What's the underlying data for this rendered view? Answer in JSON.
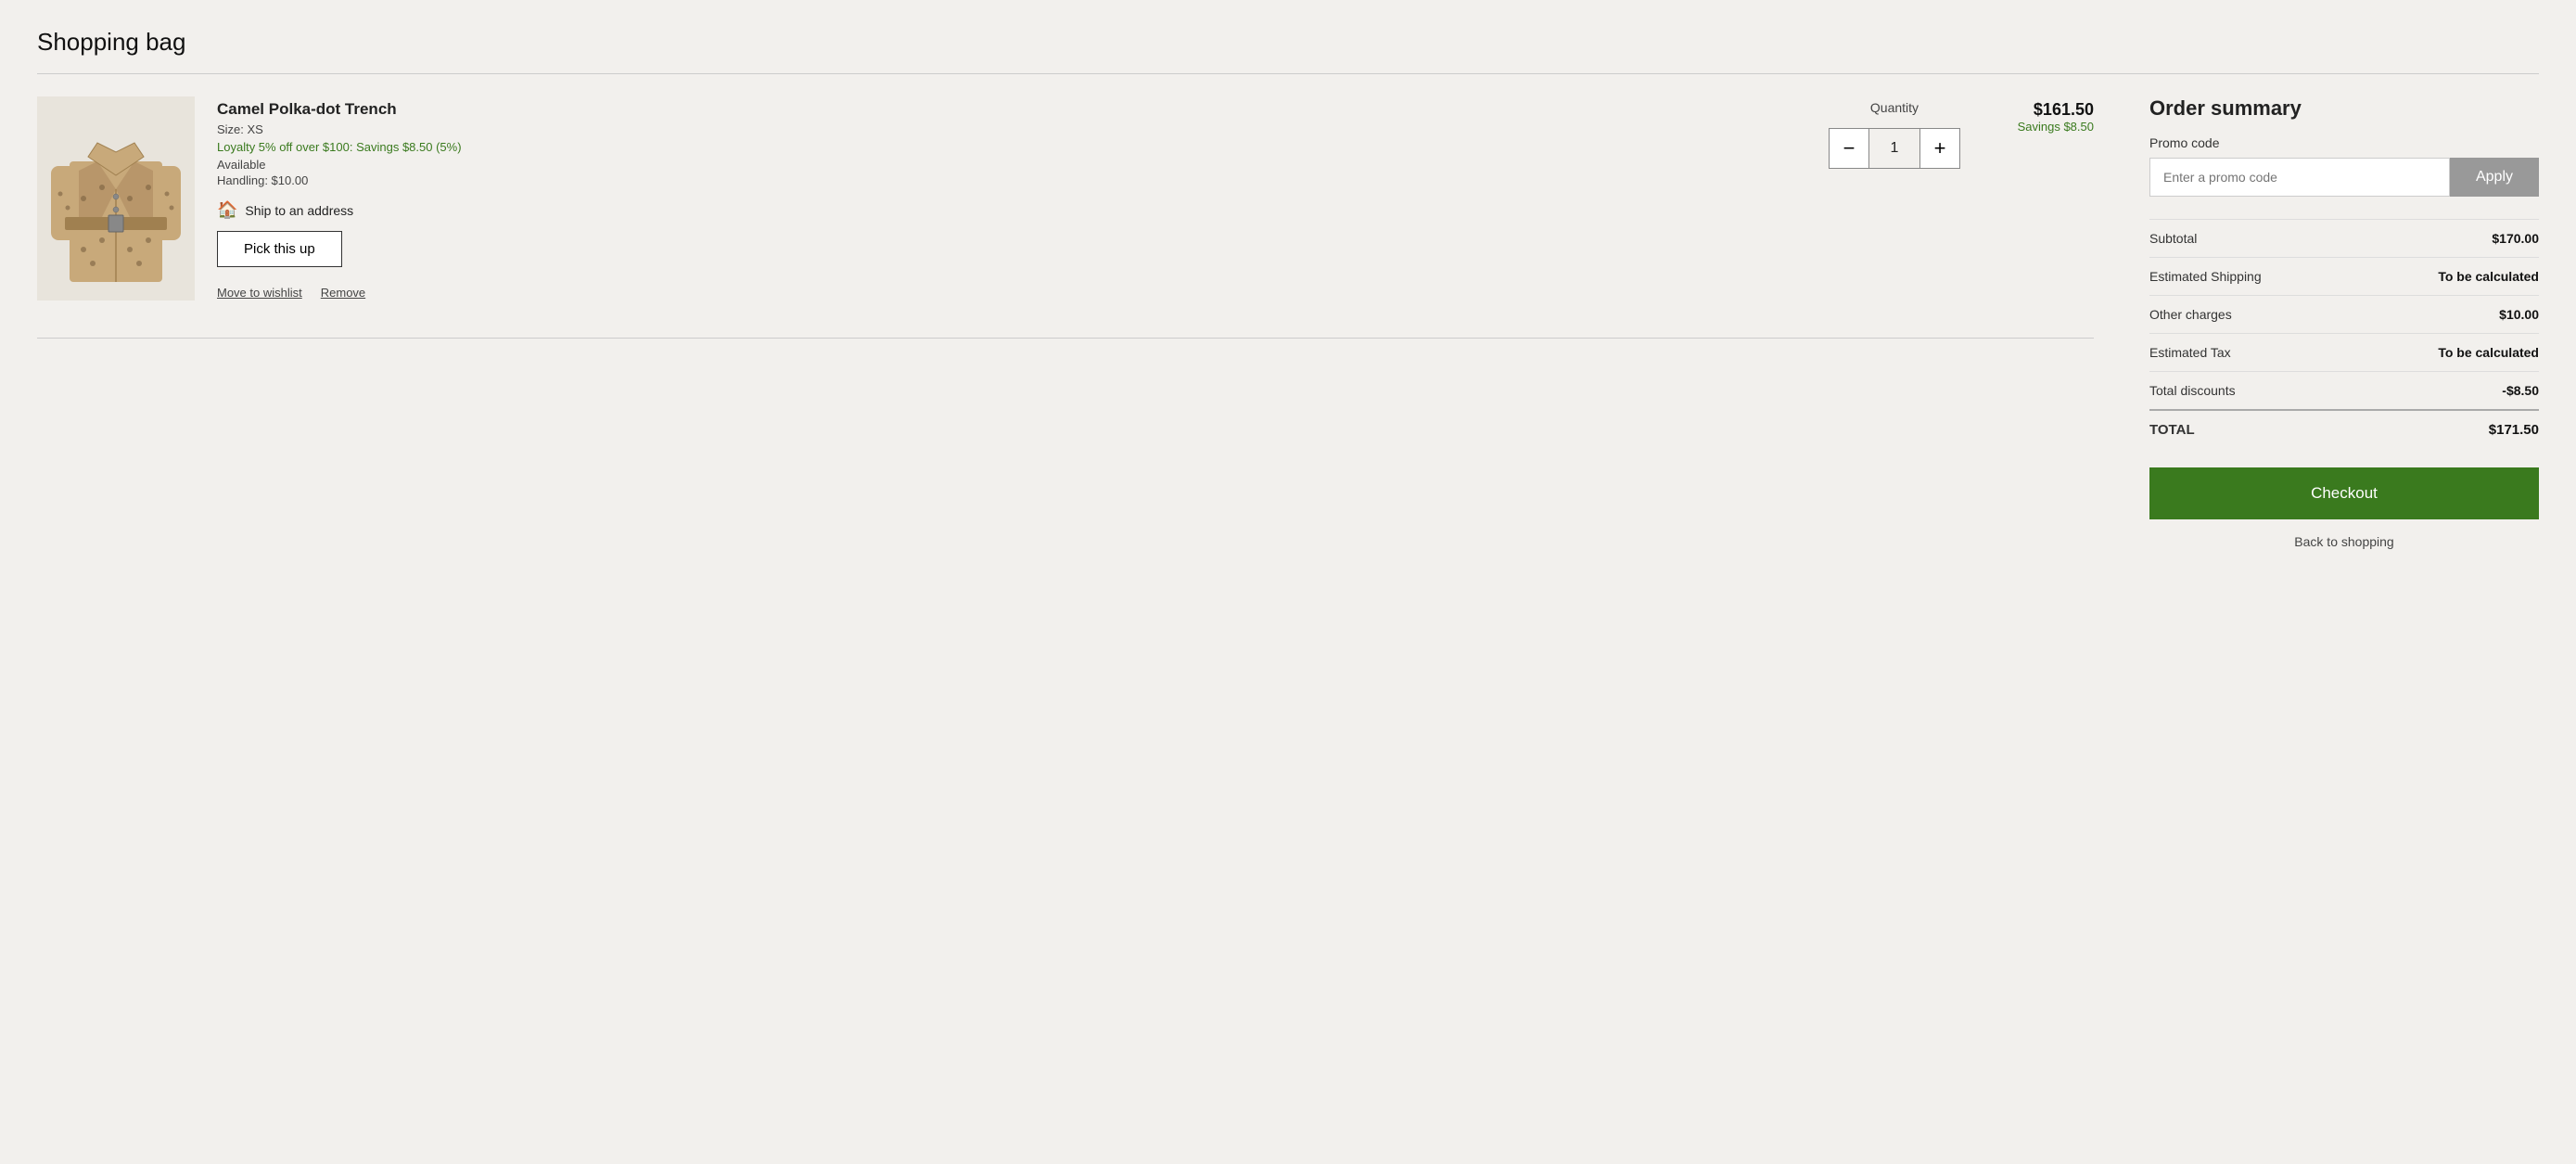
{
  "page": {
    "title": "Shopping bag"
  },
  "cart": {
    "item": {
      "name": "Camel Polka-dot Trench",
      "size_label": "Size: XS",
      "loyalty_text": "Loyalty 5% off over $100: Savings $8.50 (5%)",
      "availability": "Available",
      "handling": "Handling: $10.00",
      "ship_to_address": "Ship to an address",
      "pickup_button_label": "Pick this up",
      "quantity_label": "Quantity",
      "quantity_value": "1",
      "price": "$161.50",
      "savings": "Savings $8.50",
      "move_to_wishlist": "Move to wishlist",
      "remove": "Remove"
    }
  },
  "order_summary": {
    "title": "Order summary",
    "promo_label": "Promo code",
    "promo_placeholder": "Enter a promo code",
    "apply_label": "Apply",
    "rows": [
      {
        "label": "Subtotal",
        "value": "$170.00",
        "bold": true
      },
      {
        "label": "Estimated Shipping",
        "value": "To be calculated",
        "bold": true
      },
      {
        "label": "Other charges",
        "value": "$10.00",
        "bold": true
      },
      {
        "label": "Estimated Tax",
        "value": "To be calculated",
        "bold": true
      },
      {
        "label": "Total discounts",
        "value": "-$8.50",
        "bold": true
      }
    ],
    "total_label": "TOTAL",
    "total_value": "$171.50",
    "checkout_label": "Checkout",
    "back_to_shopping": "Back to shopping"
  },
  "icons": {
    "minus": "−",
    "plus": "+",
    "ship": "🏠"
  }
}
